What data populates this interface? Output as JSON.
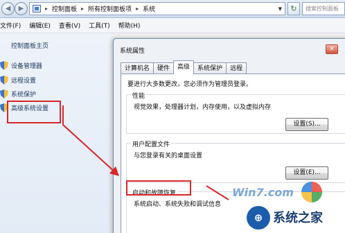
{
  "explorer": {
    "breadcrumbs": [
      "控制面板",
      "所有控制面板项",
      "系统"
    ],
    "search_placeholder": "搜索控制面板",
    "menu": [
      "文件(F)",
      "编辑(E)",
      "查看(V)",
      "工具(T)",
      "帮助(H)"
    ]
  },
  "left_pane": {
    "home": "控制面板主页",
    "items": [
      "设备管理器",
      "远程设置",
      "系统保护",
      "高级系统设置"
    ]
  },
  "dialog": {
    "title": "系统属性",
    "close_glyph": "✕",
    "tabs": [
      "计算机名",
      "硬件",
      "高级",
      "系统保护",
      "远程"
    ],
    "active_tab": "高级",
    "admin_notice": "要进行大多数更改，您必须作为管理员登录。",
    "performance": {
      "title": "性能",
      "desc": "视觉效果，处理器计划，内存使用，以及虚拟内存",
      "button": "设置(S)..."
    },
    "user_profiles": {
      "title": "用户配置文件",
      "desc": "与您登录有关的桌面设置",
      "button": "设置(E)..."
    },
    "startup_recovery": {
      "title": "启动和故障恢复",
      "desc": "系统启动、系统失败和调试信息"
    }
  },
  "watermark": {
    "brand_text": "系统之家"
  },
  "colors": {
    "annotation_red": "#d8262a",
    "left_pane_text": "#1e395b",
    "dialog_border": "#6f8aaf"
  }
}
